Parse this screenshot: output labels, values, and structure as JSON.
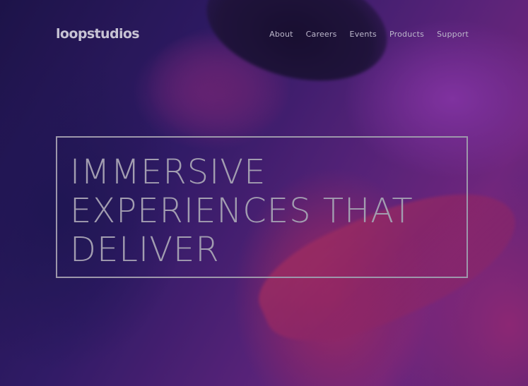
{
  "brand": {
    "logo_text": "loopstudios"
  },
  "nav": {
    "items": [
      {
        "label": "About"
      },
      {
        "label": "Careers"
      },
      {
        "label": "Events"
      },
      {
        "label": "Products"
      },
      {
        "label": "Support"
      }
    ]
  },
  "hero": {
    "headline_lines": [
      "IMMERSIVE",
      "EXPERIENCES THAT",
      "DELIVER"
    ],
    "background_image": "vr-headset-person-photo"
  },
  "colors": {
    "text_muted": "#a29db0",
    "overlay_purple": "#2a1a55",
    "magenta": "#d0326e"
  }
}
